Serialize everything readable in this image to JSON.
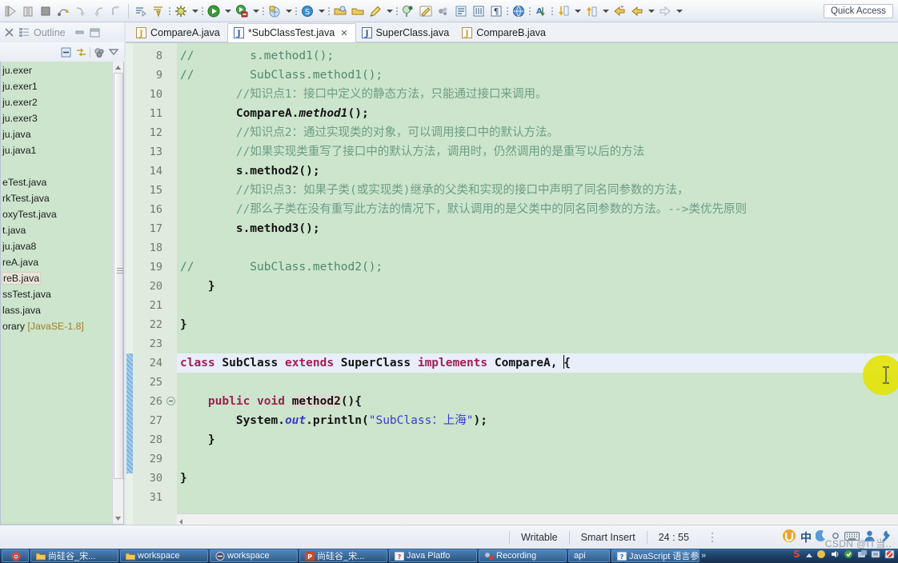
{
  "toolbar": {
    "quick_access": "Quick Access",
    "icons": [
      "run-debug-icon",
      "pause-icon",
      "stop-icon",
      "step-over-icon",
      "step-into-icon",
      "step-return-icon",
      "step-out-icon",
      "skip-breakpoints-icon",
      "drop-to-frame-icon",
      "debug-icon",
      "run-icon",
      "coverage-icon",
      "external-tools-icon",
      "search-icon",
      "open-type-icon",
      "open-task-icon",
      "new-java-project-icon",
      "pencil-icon",
      "marker-icon",
      "highlight-icon",
      "toggle-mark-icon",
      "outline-icon",
      "block-icon",
      "paragraph-icon",
      "globe-icon",
      "sort-icon",
      "next-annotation-icon",
      "previous-annotation-icon",
      "back-icon",
      "forward-icon",
      "next-edit-icon"
    ]
  },
  "left_panel": {
    "view_tab": "Outline",
    "tab_icon": "close-icon",
    "outline_icon": "outline-icon",
    "minimize_icon": "minimize-icon",
    "maximize_icon": "maximize-icon",
    "toolbar_icons": [
      "collapse-all-icon",
      "link-with-editor-icon",
      "filter-icon",
      "view-menu-icon"
    ],
    "tree_items": [
      {
        "label": "ju.exer",
        "selected": false
      },
      {
        "label": "ju.exer1",
        "selected": false
      },
      {
        "label": "ju.exer2",
        "selected": false
      },
      {
        "label": "ju.exer3",
        "selected": false
      },
      {
        "label": "ju.java",
        "selected": false
      },
      {
        "label": "ju.java1",
        "selected": false
      },
      {
        "label": "",
        "selected": false
      },
      {
        "label": "eTest.java",
        "selected": false
      },
      {
        "label": "rkTest.java",
        "selected": false
      },
      {
        "label": "oxyTest.java",
        "selected": false
      },
      {
        "label": "t.java",
        "selected": false
      },
      {
        "label": "ju.java8",
        "selected": false
      },
      {
        "label": "reA.java",
        "selected": false
      },
      {
        "label": "reB.java",
        "selected": true
      },
      {
        "label": "ssTest.java",
        "selected": false
      },
      {
        "label": "lass.java",
        "selected": false
      },
      {
        "label": "orary",
        "suffix": " [JavaSE-1.8]",
        "selected": false
      }
    ]
  },
  "editor": {
    "tabs": [
      {
        "label": "CompareA.java",
        "active": false,
        "dirty": false,
        "closable": false
      },
      {
        "label": "*SubClassTest.java",
        "active": true,
        "dirty": true,
        "closable": true
      },
      {
        "label": "SuperClass.java",
        "active": false,
        "dirty": false,
        "closable": false
      },
      {
        "label": "CompareB.java",
        "active": false,
        "dirty": false,
        "closable": false
      }
    ],
    "first_line_number": 8,
    "current_line": 24,
    "lines": [
      {
        "n": 8,
        "text": "//        s.method1();"
      },
      {
        "n": 9,
        "text": "//        SubClass.method1();"
      },
      {
        "n": 10,
        "text": "        //知识点1：接口中定义的静态方法，只能通过接口来调用。"
      },
      {
        "n": 11,
        "text": "        CompareA.method1();"
      },
      {
        "n": 12,
        "text": "        //知识点2：通过实现类的对象，可以调用接口中的默认方法。"
      },
      {
        "n": 13,
        "text": "        //如果实现类重写了接口中的默认方法，调用时，仍然调用的是重写以后的方法"
      },
      {
        "n": 14,
        "text": "        s.method2();"
      },
      {
        "n": 15,
        "text": "        //知识点3：如果子类(或实现类)继承的父类和实现的接口中声明了同名同参数的方法，"
      },
      {
        "n": 16,
        "text": "        //那么子类在没有重写此方法的情况下，默认调用的是父类中的同名同参数的方法。-->类优先原则"
      },
      {
        "n": 17,
        "text": "        s.method3();"
      },
      {
        "n": 18,
        "text": ""
      },
      {
        "n": 19,
        "text": "//        SubClass.method2();"
      },
      {
        "n": 20,
        "text": "    }"
      },
      {
        "n": 21,
        "text": ""
      },
      {
        "n": 22,
        "text": "}"
      },
      {
        "n": 23,
        "text": ""
      },
      {
        "n": 24,
        "text": "class SubClass extends SuperClass implements CompareA, {"
      },
      {
        "n": 25,
        "text": ""
      },
      {
        "n": 26,
        "text": "    public void method2(){"
      },
      {
        "n": 27,
        "text": "        System.out.println(\"SubClass：上海\");"
      },
      {
        "n": 28,
        "text": "    }"
      },
      {
        "n": 29,
        "text": ""
      },
      {
        "n": 30,
        "text": "}"
      },
      {
        "n": 31,
        "text": ""
      }
    ]
  },
  "status_bar": {
    "writable": "Writable",
    "insert_mode": "Smart Insert",
    "position": "24 : 55",
    "tray_icons": [
      "sogou-ime-icon",
      "chinese-mode-icon",
      "moon-icon",
      "circle-icon",
      "keyboard-icon",
      "user-icon",
      "wrench-icon"
    ]
  },
  "watermark": "CSDN @IT当..",
  "taskbar": {
    "items": [
      {
        "label": "",
        "icon": "chrome-icon"
      },
      {
        "label": "尚硅谷_宋...",
        "icon": "folder-icon"
      },
      {
        "label": "workspace",
        "icon": "folder-icon"
      },
      {
        "label": "workspace",
        "icon": "eclipse-icon"
      },
      {
        "label": "尚硅谷_宋...",
        "icon": "powerpoint-icon"
      },
      {
        "label": "Java Platfo",
        "icon": "help-icon"
      },
      {
        "label": "Recording",
        "icon": "record-icon"
      },
      {
        "label": "api",
        "icon": "help-icon"
      },
      {
        "label": "JavaScript 语言参考",
        "icon": "help-icon"
      }
    ],
    "overflow": "»",
    "tray": [
      "sogou-icon",
      "show-hidden-icon",
      "volume-icon",
      "update-icon",
      "network-icon",
      "battery-icon",
      "shield-icon"
    ]
  }
}
